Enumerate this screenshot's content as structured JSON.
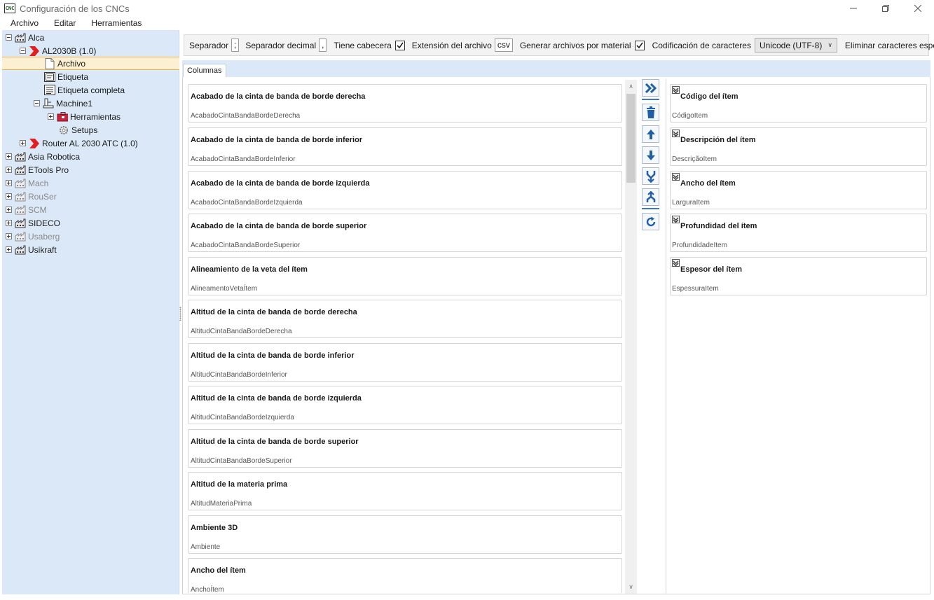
{
  "window": {
    "title": "Configuración de los CNCs",
    "app_icon_text": "CNC"
  },
  "menu": {
    "items": [
      "Archivo",
      "Editar",
      "Herramientas"
    ]
  },
  "tree": {
    "alca": "Alca",
    "al2030b": "AL2030B (1.0)",
    "archivo": "Archivo",
    "etiqueta": "Etiqueta",
    "etiqueta_completa": "Etiqueta completa",
    "machine1": "Machine1",
    "herramientas": "Herramientas",
    "setups": "Setups",
    "router": "Router AL 2030 ATC (1.0)",
    "asia_robotica": "Asia Robotica",
    "etools_pro": "ETools Pro",
    "mach": "Mach",
    "rouser": "RouSer",
    "scm": "SCM",
    "sideco": "SIDECO",
    "usaberg": "Usaberg",
    "usikraft": "Usikraft"
  },
  "options": {
    "separador_label": "Separador",
    "separador_value": ";",
    "separador_decimal_label": "Separador decimal",
    "separador_decimal_value": ",",
    "tiene_cabecera_label": "Tiene cabecera",
    "tiene_cabecera_checked": true,
    "extension_label": "Extensión del archivo",
    "extension_value": "csv",
    "generar_label": "Generar archivos por material",
    "generar_checked": true,
    "codificacion_label": "Codificación de caracteres",
    "codificacion_value": "Unicode (UTF-8)",
    "eliminar_label": "Eliminar caracteres especiales",
    "eliminar_checked": false
  },
  "tabs": {
    "columnas": "Columnas"
  },
  "available_columns": [
    {
      "title": "Acabado de la cinta de banda de borde derecha",
      "field": "AcabadoCintaBandaBordeDerecha"
    },
    {
      "title": "Acabado de la cinta de banda de borde inferior",
      "field": "AcabadoCintaBandaBordeInferior"
    },
    {
      "title": "Acabado de la cinta de banda de borde izquierda",
      "field": "AcabadoCintaBandaBordeIzquierda"
    },
    {
      "title": "Acabado de la cinta de banda de borde superior",
      "field": "AcabadoCintaBandaBordeSuperior"
    },
    {
      "title": "Alineamiento de la veta del ítem",
      "field": "AlineamentoVetaÍtem"
    },
    {
      "title": "Altitud de la cinta de banda de borde derecha",
      "field": "AltitudCintaBandaBordeDerecha"
    },
    {
      "title": "Altitud de la cinta de banda de borde inferior",
      "field": "AltitudCintaBandaBordeInferior"
    },
    {
      "title": "Altitud de la cinta de banda de borde izquierda",
      "field": "AltitudCintaBandaBordeIzquierda"
    },
    {
      "title": "Altitud de la cinta de banda de borde superior",
      "field": "AltitudCintaBandaBordeSuperior"
    },
    {
      "title": "Altitud de la materia prima",
      "field": "AltitudMateriaPrima"
    },
    {
      "title": "Ambiente 3D",
      "field": "Ambiente"
    },
    {
      "title": "Ancho del ítem",
      "field": "AnchoÍtem"
    }
  ],
  "selected_columns": [
    {
      "title": "Código del ítem",
      "field": "CódigoItem"
    },
    {
      "title": "Descripción del ítem",
      "field": "DescriçãoItem"
    },
    {
      "title": "Ancho del ítem",
      "field": "LarguraItem"
    },
    {
      "title": "Profundidad del ítem",
      "field": "ProfundidadeItem"
    },
    {
      "title": "Espesor del ítem",
      "field": "EspessuraItem"
    }
  ],
  "colors": {
    "tree_bg": "#dbe8f7",
    "selection_bg": "#fdefd1",
    "selection_border": "#f0b252",
    "toolbar_icon": "#1f5fa8",
    "machine_red": "#e02020"
  }
}
